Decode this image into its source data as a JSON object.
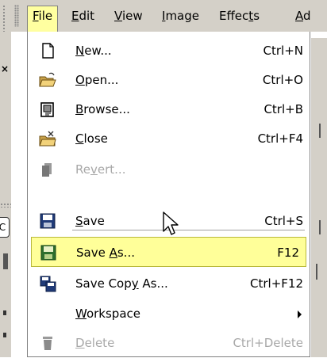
{
  "menubar": {
    "items": [
      {
        "text": "File",
        "key": "F",
        "rest": "ile",
        "active": true
      },
      {
        "text": "Edit",
        "key": "E",
        "rest": "dit"
      },
      {
        "text": "View",
        "key": "V",
        "rest": "iew"
      },
      {
        "text": "Image",
        "key": "I",
        "rest": "mage"
      },
      {
        "text": "Effects",
        "pre": "Effec",
        "key": "t",
        "post": "s"
      },
      {
        "text": "Ad",
        "key": "A",
        "rest": "d"
      }
    ]
  },
  "file_menu": {
    "items": [
      {
        "pre": "",
        "key": "N",
        "post": "ew...",
        "shortcut": "Ctrl+N",
        "icon": "new-document-icon",
        "enabled": true
      },
      {
        "pre": "",
        "key": "O",
        "post": "pen...",
        "shortcut": "Ctrl+O",
        "icon": "open-folder-icon",
        "enabled": true
      },
      {
        "pre": "",
        "key": "B",
        "post": "rowse...",
        "shortcut": "Ctrl+B",
        "icon": "browse-icon",
        "enabled": true
      },
      {
        "pre": "",
        "key": "C",
        "post": "lose",
        "shortcut": "Ctrl+F4",
        "icon": "close-folder-icon",
        "enabled": true
      },
      {
        "pre": "Re",
        "key": "v",
        "post": "ert...",
        "shortcut": "",
        "icon": "revert-icon",
        "enabled": false
      },
      {
        "pre": "",
        "key": "S",
        "post": "ave",
        "shortcut": "Ctrl+S",
        "icon": "save-icon",
        "enabled": true
      },
      {
        "pre": "Save ",
        "key": "A",
        "post": "s...",
        "shortcut": "F12",
        "icon": "save-as-icon",
        "enabled": true,
        "highlighted": true
      },
      {
        "pre": "Save Cop",
        "key": "y",
        "post": " As...",
        "shortcut": "Ctrl+F12",
        "icon": "save-copy-icon",
        "enabled": true
      },
      {
        "pre": "",
        "key": "W",
        "post": "orkspace",
        "shortcut": "",
        "icon": "",
        "enabled": true,
        "submenu": true
      },
      {
        "pre": "",
        "key": "D",
        "post": "elete",
        "shortcut": "Ctrl+Delete",
        "icon": "trash-icon",
        "enabled": false
      }
    ]
  },
  "left_strip": {
    "close_glyph": "×",
    "c_label": "C"
  },
  "colors": {
    "highlight": "#ffff99",
    "menubar": "#d4d0c8",
    "disabled_text": "#a8a8a8"
  }
}
